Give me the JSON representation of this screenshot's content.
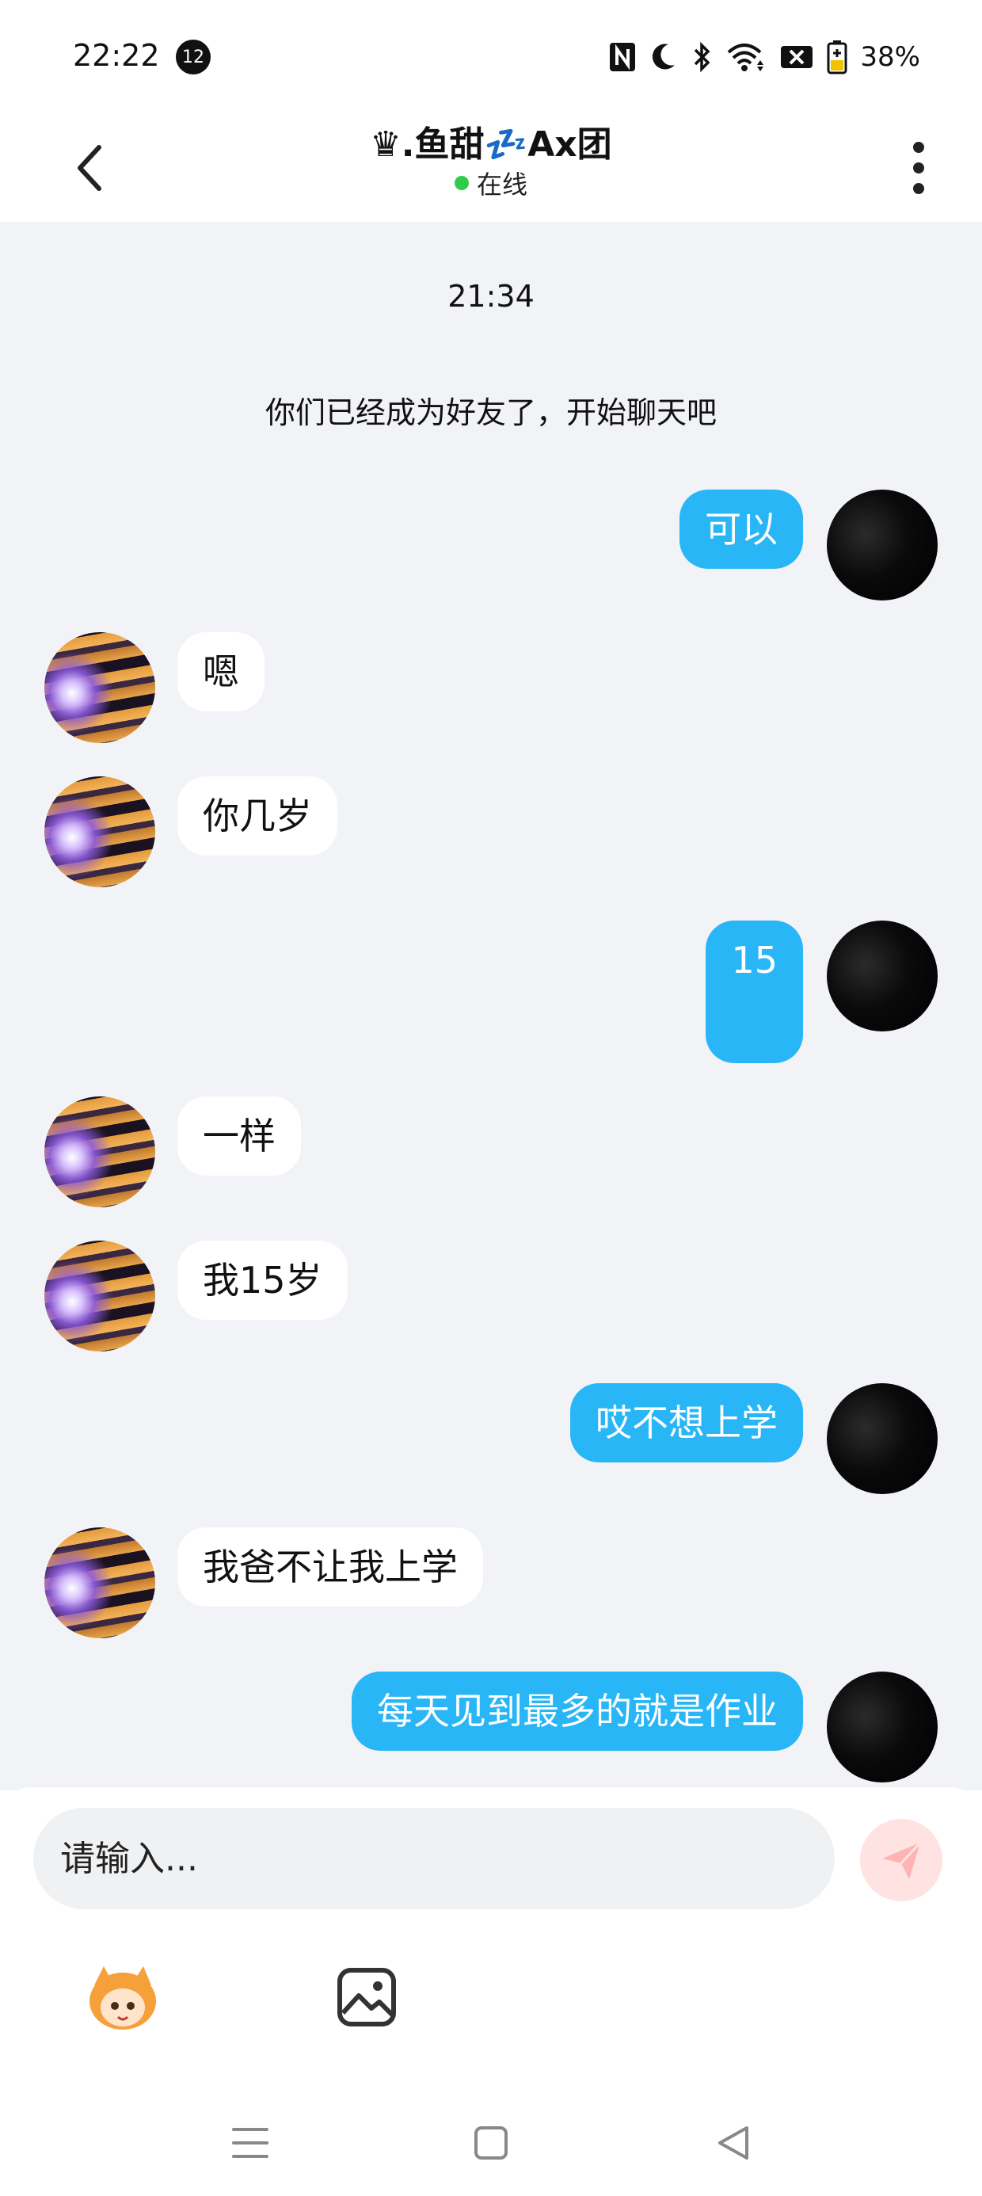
{
  "status_bar": {
    "time": "22:22",
    "notification_count": "12",
    "battery": "38%"
  },
  "header": {
    "title": "♛.鱼甜💤Ax团",
    "presence": "在线",
    "presence_color": "#2fcc4a"
  },
  "chat": {
    "timestamp": "21:34",
    "system_message": "你们已经成为好友了，开始聊天吧",
    "messages": [
      {
        "from": "self",
        "text": "可以"
      },
      {
        "from": "other",
        "text": "嗯"
      },
      {
        "from": "other",
        "text": "你几岁"
      },
      {
        "from": "self",
        "text": "15"
      },
      {
        "from": "other",
        "text": "一样"
      },
      {
        "from": "other",
        "text": "我15岁"
      },
      {
        "from": "self",
        "text": "哎不想上学"
      },
      {
        "from": "other",
        "text": "我爸不让我上学"
      },
      {
        "from": "self",
        "text": "每天见到最多的就是作业"
      }
    ]
  },
  "input": {
    "placeholder": "请输入..."
  },
  "colors": {
    "outgoing_bubble": "#29b6f6",
    "incoming_bubble": "#ffffff",
    "chat_background": "#f2f3f7",
    "send_button": "#ff6b6b"
  },
  "icons": {
    "back": "chevron-left-icon",
    "more": "more-vertical-icon",
    "send": "paper-plane-icon",
    "sticker": "sticker-icon",
    "image": "image-icon"
  }
}
